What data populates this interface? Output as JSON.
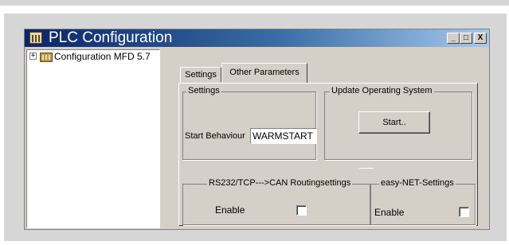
{
  "window": {
    "title": "PLC Configuration",
    "controls": {
      "minimize": "_",
      "maximize": "□",
      "close": "X"
    }
  },
  "tree": {
    "items": [
      {
        "label": "Configuration MFD 5.7",
        "expander": "+"
      }
    ]
  },
  "tabs": [
    {
      "label": "Settings",
      "active": false
    },
    {
      "label": "Other Parameters",
      "active": true
    }
  ],
  "settings_group": {
    "legend": "Settings",
    "start_behaviour_label": "Start Behaviour",
    "start_behaviour_value": "WARMSTART"
  },
  "update_group": {
    "legend": "Update Operating System",
    "start_button": "Start.."
  },
  "routing_group": {
    "legend": "RS232/TCP--->CAN Routingsettings",
    "enable_label": "Enable",
    "enable_checked": false
  },
  "easynet_group": {
    "legend": "easy-NET-Settings",
    "enable_label": "Enable",
    "enable_checked": false
  }
}
